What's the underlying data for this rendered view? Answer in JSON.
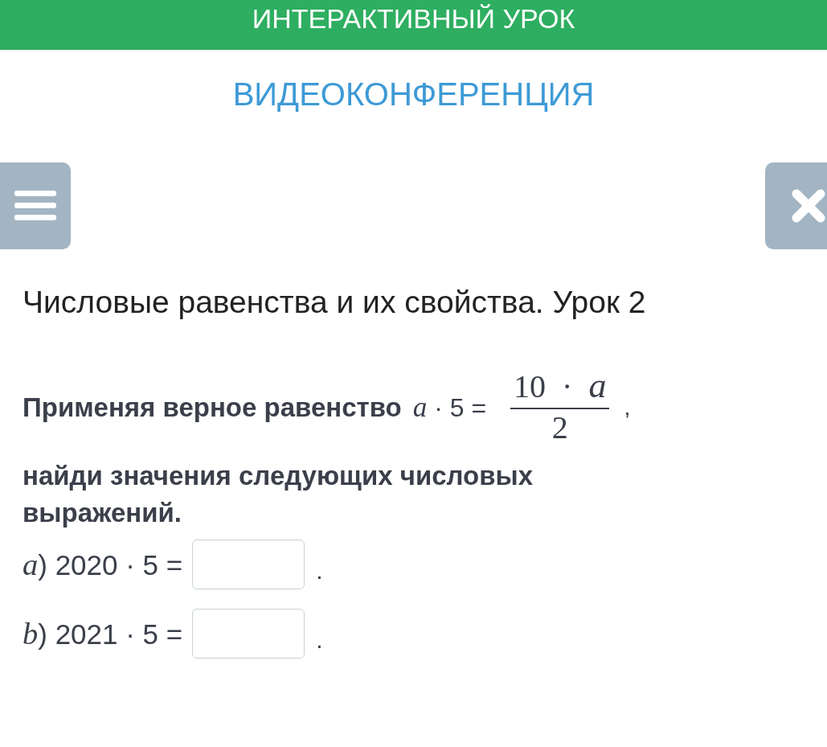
{
  "header": {
    "title": "ИНТЕРАКТИВНЫЙ УРОК"
  },
  "link": "ВИДЕОКОНФЕРЕНЦИЯ",
  "lesson_title": "Числовые равенства и их свойства. Урок 2",
  "question": {
    "text_before": "Применяя верное равенство",
    "lhs": "*a* · 5 =",
    "numerator": "10  ·  *a*",
    "denominator": "2",
    "comma": ",",
    "text_after": "найди значения следующих числовых выражений."
  },
  "items": [
    {
      "label": "*a*)",
      "expression": "2020 · 5 =",
      "value": "",
      "end": "."
    },
    {
      "label": "*b*)",
      "expression": "2021 · 5 =",
      "value": "",
      "end": "."
    }
  ]
}
